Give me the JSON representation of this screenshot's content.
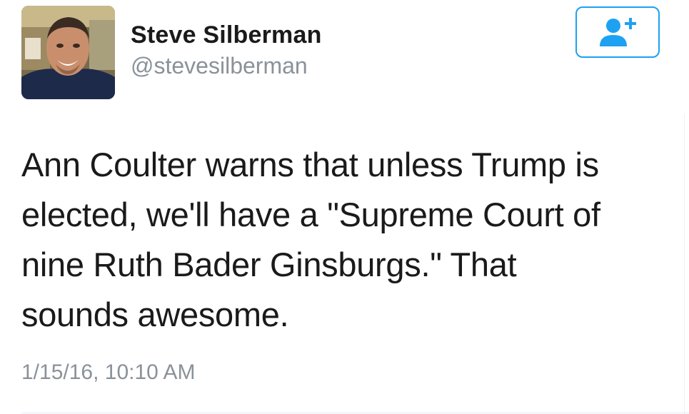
{
  "user": {
    "display_name": "Steve Silberman",
    "handle": "@stevesilberman",
    "avatar_icon": "profile-photo"
  },
  "follow_button": {
    "icon": "add-user-icon",
    "color": "#1da1f2"
  },
  "tweet": {
    "text": "Ann Coulter warns that unless Trump is\nelected, we'll have a \"Supreme Court of\nnine Ruth Bader Ginsburgs.\" That\nsounds awesome.",
    "timestamp": "1/15/16, 10:10 AM"
  }
}
